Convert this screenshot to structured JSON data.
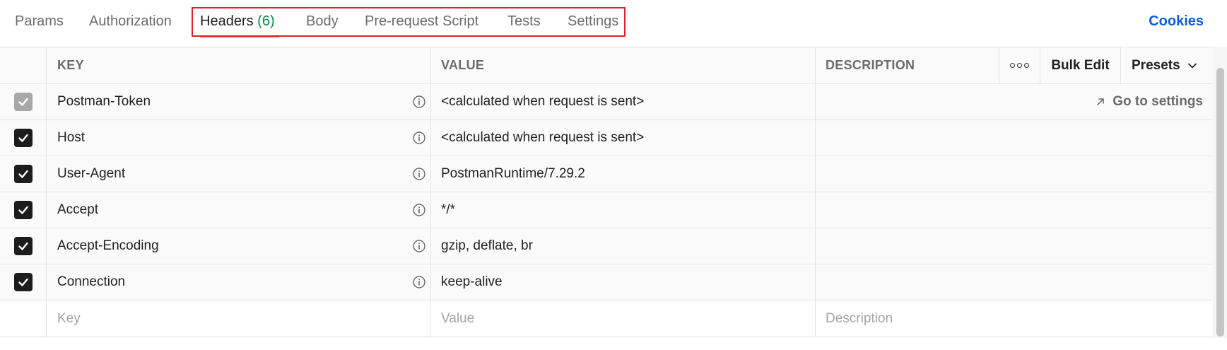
{
  "tabs": {
    "params": "Params",
    "authorization": "Authorization",
    "headers": "Headers",
    "headers_count": "(6)",
    "body": "Body",
    "prerequest": "Pre-request Script",
    "tests": "Tests",
    "settings": "Settings",
    "cookies": "Cookies"
  },
  "table": {
    "columns": {
      "key": "KEY",
      "value": "VALUE",
      "description": "DESCRIPTION",
      "bulk_edit": "Bulk Edit",
      "presets": "Presets"
    },
    "rows": [
      {
        "key": "Postman-Token",
        "value": "<calculated when request is sent>",
        "checked": true,
        "disabled": true,
        "action": "Go to settings"
      },
      {
        "key": "Host",
        "value": "<calculated when request is sent>",
        "checked": true
      },
      {
        "key": "User-Agent",
        "value": "PostmanRuntime/7.29.2",
        "checked": true
      },
      {
        "key": "Accept",
        "value": "*/*",
        "checked": true
      },
      {
        "key": "Accept-Encoding",
        "value": "gzip, deflate, br",
        "checked": true
      },
      {
        "key": "Connection",
        "value": "keep-alive",
        "checked": true
      }
    ],
    "new_row": {
      "key_placeholder": "Key",
      "value_placeholder": "Value",
      "description_placeholder": "Description"
    }
  },
  "colors": {
    "active_tab_underline": "#ff6c37",
    "highlight_border": "#e0202a",
    "cookies_link": "#0b5fd9",
    "headers_count": "#0b8a3e"
  },
  "icons": [
    "info-icon",
    "checkmark-icon",
    "more-icon",
    "chevron-down-icon",
    "arrow-up-right-icon"
  ]
}
